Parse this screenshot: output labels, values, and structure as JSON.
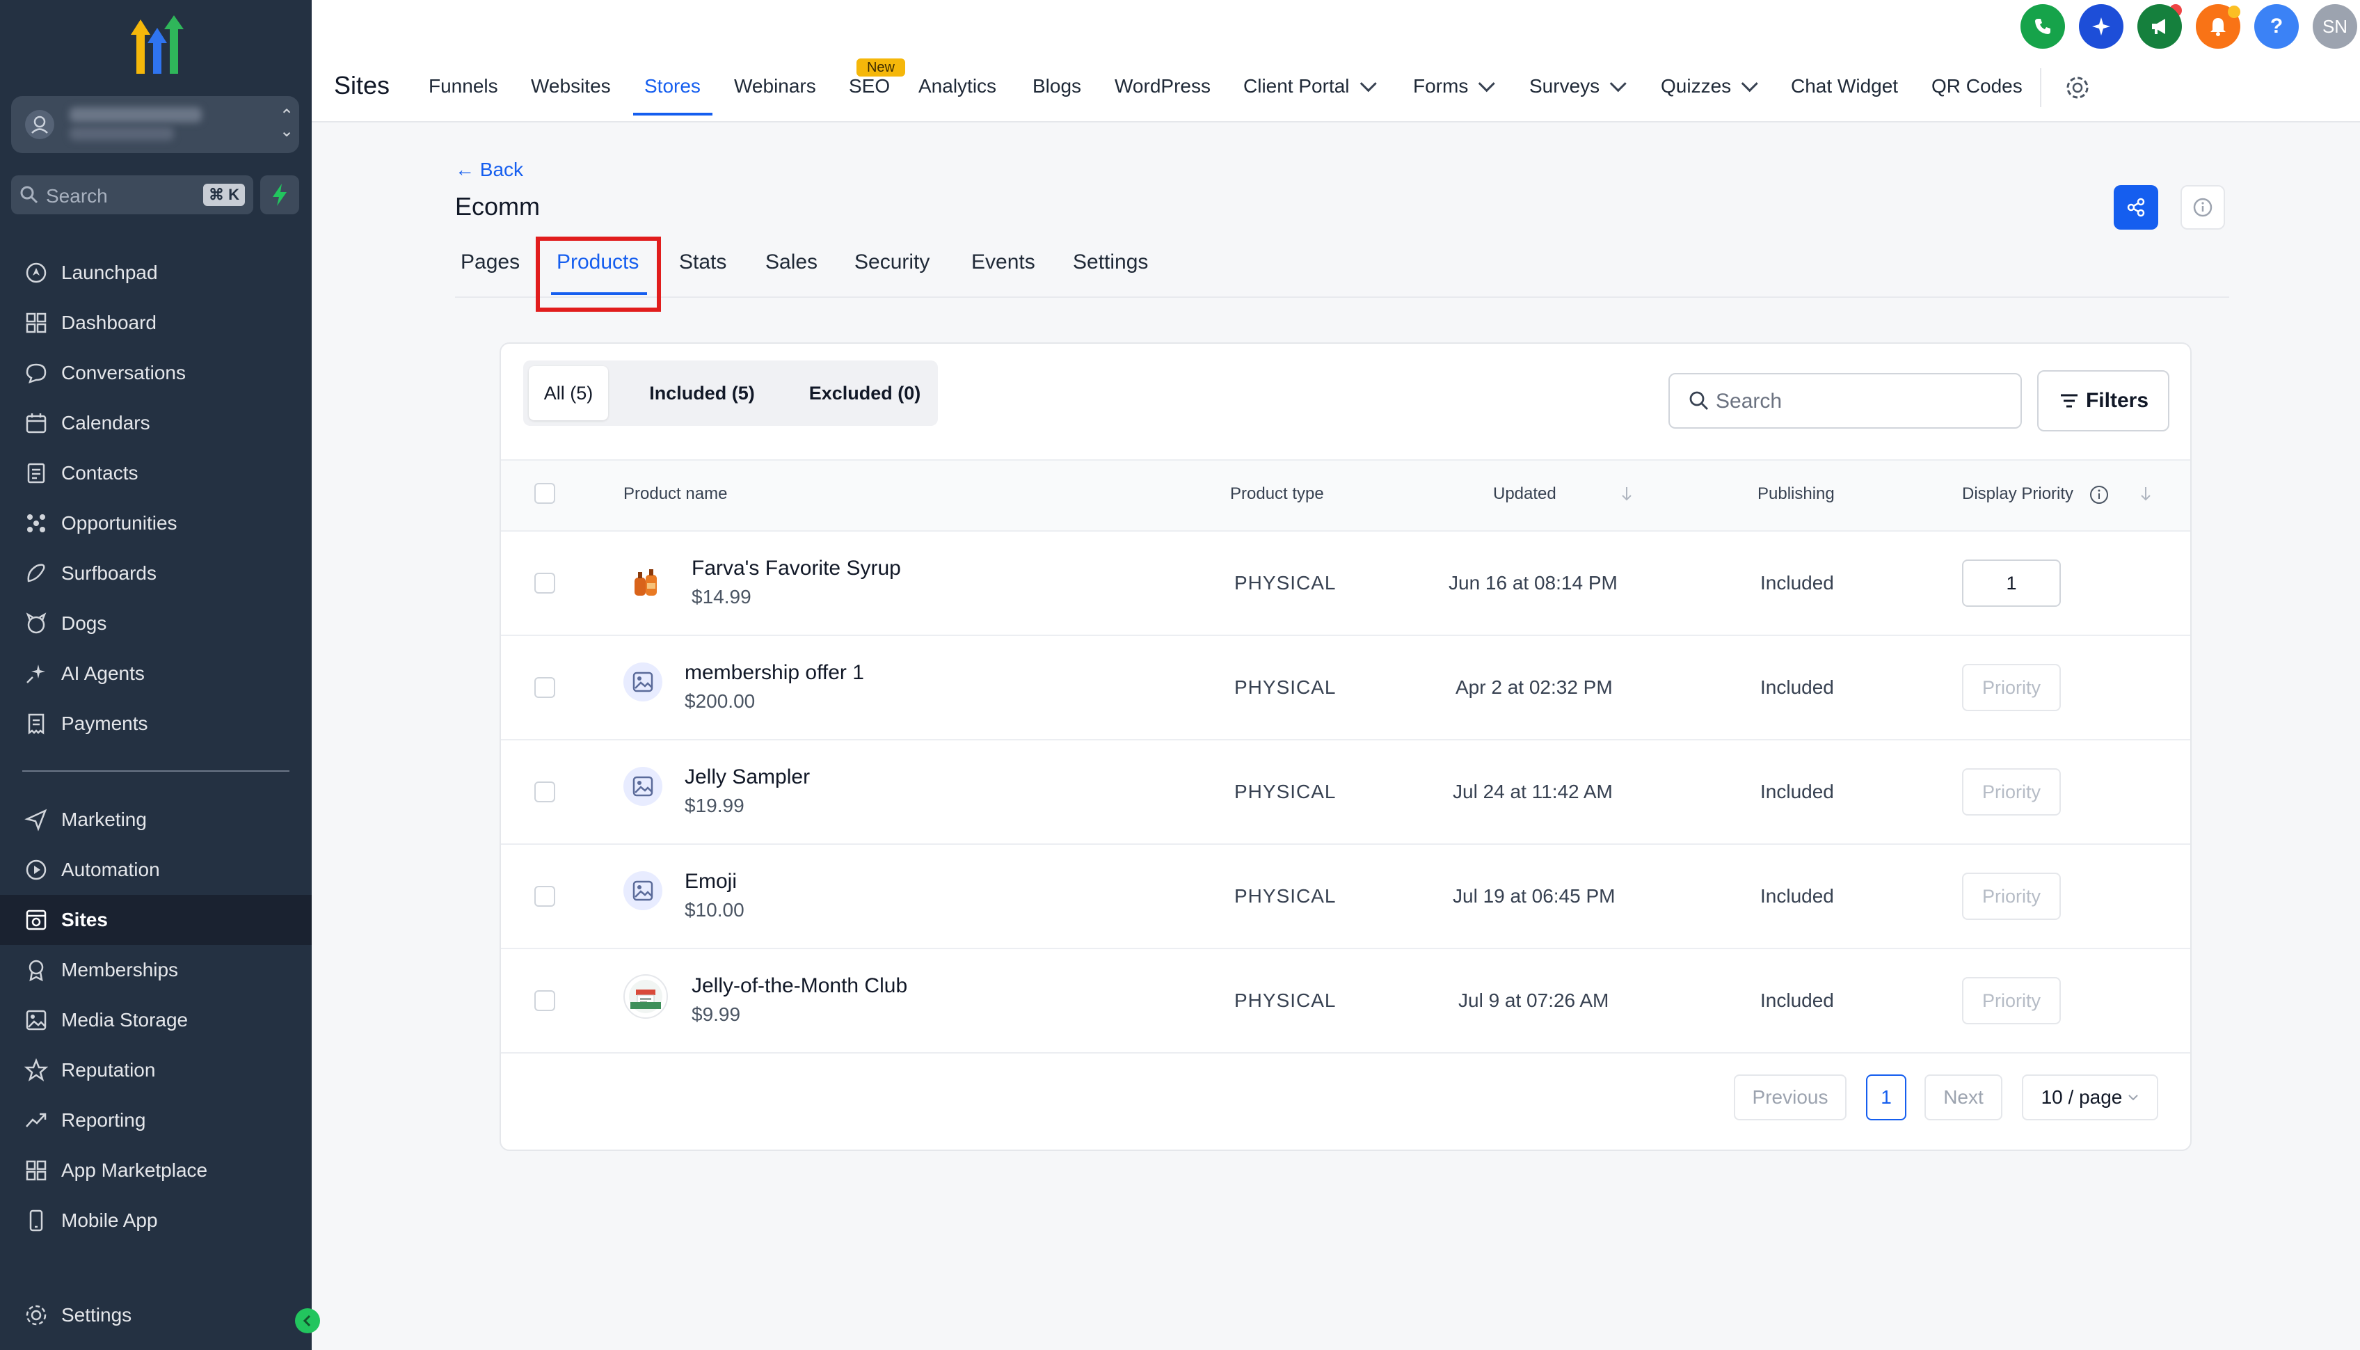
{
  "sidebar": {
    "search_placeholder": "Search",
    "search_shortcut": "⌘ K",
    "items": [
      {
        "label": "Launchpad",
        "icon": "launchpad-icon"
      },
      {
        "label": "Dashboard",
        "icon": "dashboard-icon"
      },
      {
        "label": "Conversations",
        "icon": "chat-bubble-icon"
      },
      {
        "label": "Calendars",
        "icon": "calendar-icon"
      },
      {
        "label": "Contacts",
        "icon": "contacts-icon"
      },
      {
        "label": "Opportunities",
        "icon": "opportunities-icon"
      },
      {
        "label": "Surfboards",
        "icon": "surfboard-icon"
      },
      {
        "label": "Dogs",
        "icon": "dog-icon"
      },
      {
        "label": "AI Agents",
        "icon": "sparkle-icon"
      },
      {
        "label": "Payments",
        "icon": "receipt-icon"
      }
    ],
    "items2": [
      {
        "label": "Marketing",
        "icon": "send-icon"
      },
      {
        "label": "Automation",
        "icon": "automation-icon"
      },
      {
        "label": "Sites",
        "icon": "sites-icon",
        "active": true
      },
      {
        "label": "Memberships",
        "icon": "badge-icon"
      },
      {
        "label": "Media Storage",
        "icon": "image-icon"
      },
      {
        "label": "Reputation",
        "icon": "star-icon"
      },
      {
        "label": "Reporting",
        "icon": "trend-icon"
      },
      {
        "label": "App Marketplace",
        "icon": "apps-icon"
      },
      {
        "label": "Mobile App",
        "icon": "mobile-icon"
      }
    ],
    "settings_label": "Settings"
  },
  "topbar": {
    "title": "Sites",
    "nav": [
      "Funnels",
      "Websites",
      "Stores",
      "Webinars",
      "SEO",
      "Analytics",
      "Blogs",
      "WordPress",
      "Client Portal",
      "Forms",
      "Surveys",
      "Quizzes",
      "Chat Widget",
      "QR Codes"
    ],
    "new_badge": "New",
    "avatar_initials": "SN",
    "help_glyph": "?"
  },
  "header": {
    "back_label": "Back",
    "page_title": "Ecomm",
    "subtabs": [
      "Pages",
      "Products",
      "Stats",
      "Sales",
      "Security",
      "Events",
      "Settings"
    ],
    "active_subtab": "Products"
  },
  "filters": {
    "segments": [
      "All (5)",
      "Included (5)",
      "Excluded (0)"
    ],
    "search_placeholder": "Search",
    "filters_label": "Filters"
  },
  "table": {
    "headers": [
      "Product name",
      "Product type",
      "Updated",
      "Publishing",
      "Display Priority"
    ],
    "rows": [
      {
        "name": "Farva's Favorite Syrup",
        "price": "$14.99",
        "type": "PHYSICAL",
        "updated": "Jun 16 at 08:14 PM",
        "publishing": "Included",
        "priority": "1"
      },
      {
        "name": "membership offer 1",
        "price": "$200.00",
        "type": "PHYSICAL",
        "updated": "Apr 2 at 02:32 PM",
        "publishing": "Included",
        "priority": "Priority"
      },
      {
        "name": "Jelly Sampler",
        "price": "$19.99",
        "type": "PHYSICAL",
        "updated": "Jul 24 at 11:42 AM",
        "publishing": "Included",
        "priority": "Priority"
      },
      {
        "name": "Emoji",
        "price": "$10.00",
        "type": "PHYSICAL",
        "updated": "Jul 19 at 06:45 PM",
        "publishing": "Included",
        "priority": "Priority"
      },
      {
        "name": "Jelly-of-the-Month Club",
        "price": "$9.99",
        "type": "PHYSICAL",
        "updated": "Jul 9 at 07:26 AM",
        "publishing": "Included",
        "priority": "Priority"
      }
    ]
  },
  "pagination": {
    "prev_label": "Previous",
    "current_page": "1",
    "next_label": "Next",
    "page_size": "10 / page"
  },
  "colors": {
    "accent": "#155eef",
    "sidebar_bg": "#243142",
    "highlight_box": "#e11d1d"
  }
}
